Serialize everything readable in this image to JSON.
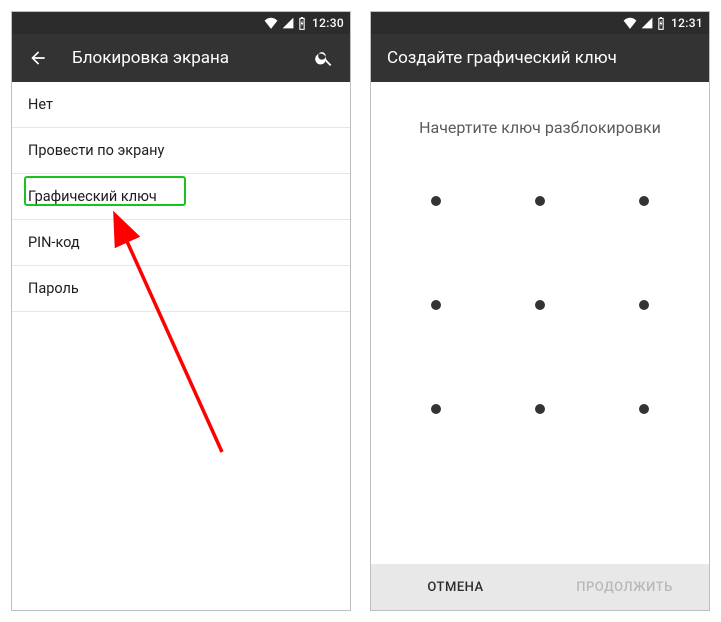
{
  "left": {
    "status_time": "12:30",
    "app_title": "Блокировка экрана",
    "items": [
      {
        "label": "Нет"
      },
      {
        "label": "Провести по экрану"
      },
      {
        "label": "Графический ключ"
      },
      {
        "label": "PIN-код"
      },
      {
        "label": "Пароль"
      }
    ]
  },
  "right": {
    "status_time": "12:31",
    "app_title": "Создайте графический ключ",
    "instruction": "Начертите ключ разблокировки",
    "cancel_label": "ОТМЕНА",
    "continue_label": "ПРОДОЛЖИТЬ"
  },
  "highlight_color": "#19c21f",
  "arrow_color": "#ff0000"
}
